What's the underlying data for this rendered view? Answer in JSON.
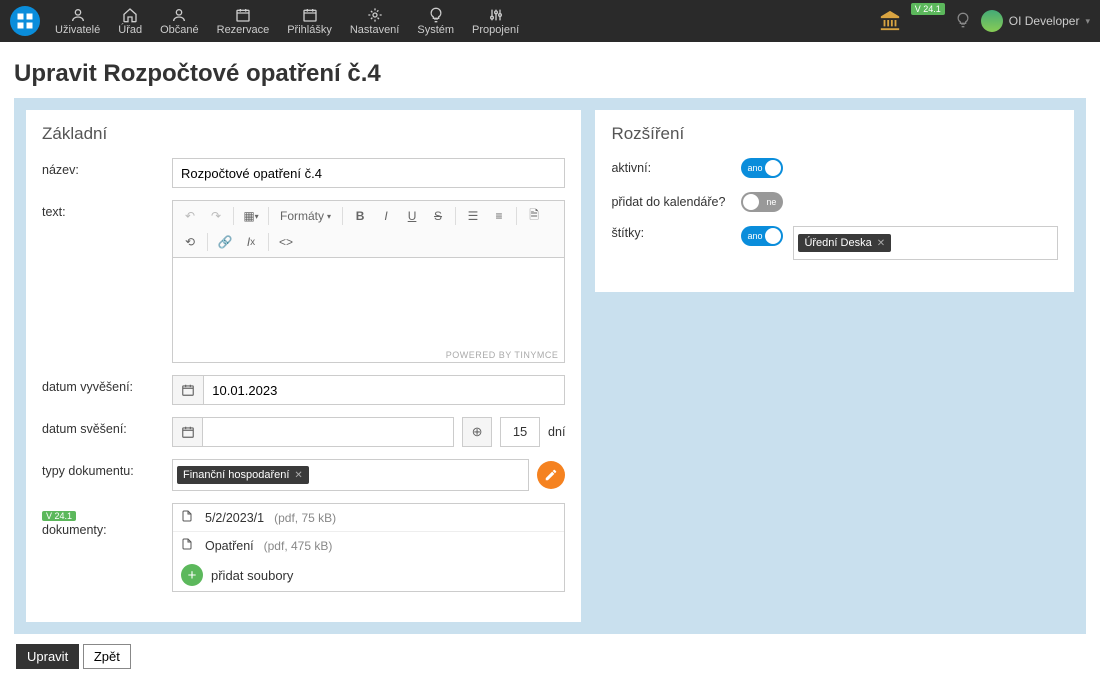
{
  "nav": {
    "items": [
      {
        "label": "Uživatelé",
        "icon": "user"
      },
      {
        "label": "Úřad",
        "icon": "home"
      },
      {
        "label": "Občané",
        "icon": "user"
      },
      {
        "label": "Rezervace",
        "icon": "calendar"
      },
      {
        "label": "Přihlášky",
        "icon": "calendar"
      },
      {
        "label": "Nastavení",
        "icon": "gear"
      },
      {
        "label": "Systém",
        "icon": "bulb"
      },
      {
        "label": "Propojení",
        "icon": "sliders"
      }
    ],
    "version": "V 24.1",
    "user": "OI Developer"
  },
  "page": {
    "title": "Upravit Rozpočtové opatření č.4"
  },
  "basic": {
    "heading": "Základní",
    "name_label": "název:",
    "name_value": "Rozpočtové opatření č.4",
    "text_label": "text:",
    "formats_label": "Formáty",
    "editor_footer": "POWERED BY TINYMCE",
    "date_post_label": "datum vyvěšení:",
    "date_post_value": "10.01.2023",
    "date_remove_label": "datum svěšení:",
    "date_remove_value": "",
    "days_value": "15",
    "days_label": "dní",
    "doc_types_label": "typy dokumentu:",
    "doc_type_tag": "Finanční hospodaření",
    "docs_label": "dokumenty:",
    "docs_badge": "V 24.1",
    "docs": [
      {
        "name": "5/2/2023/1",
        "meta": "(pdf, 75 kB)"
      },
      {
        "name": "Opatření",
        "meta": "(pdf, 475 kB)"
      }
    ],
    "add_files_label": "přidat soubory"
  },
  "ext": {
    "heading": "Rozšíření",
    "active_label": "aktivní:",
    "active_on": "ano",
    "calendar_label": "přidat do kalendáře?",
    "calendar_off": "ne",
    "tags_label": "štítky:",
    "tags_on": "ano",
    "tag_value": "Úřední Deska"
  },
  "actions": {
    "submit": "Upravit",
    "back": "Zpět"
  }
}
